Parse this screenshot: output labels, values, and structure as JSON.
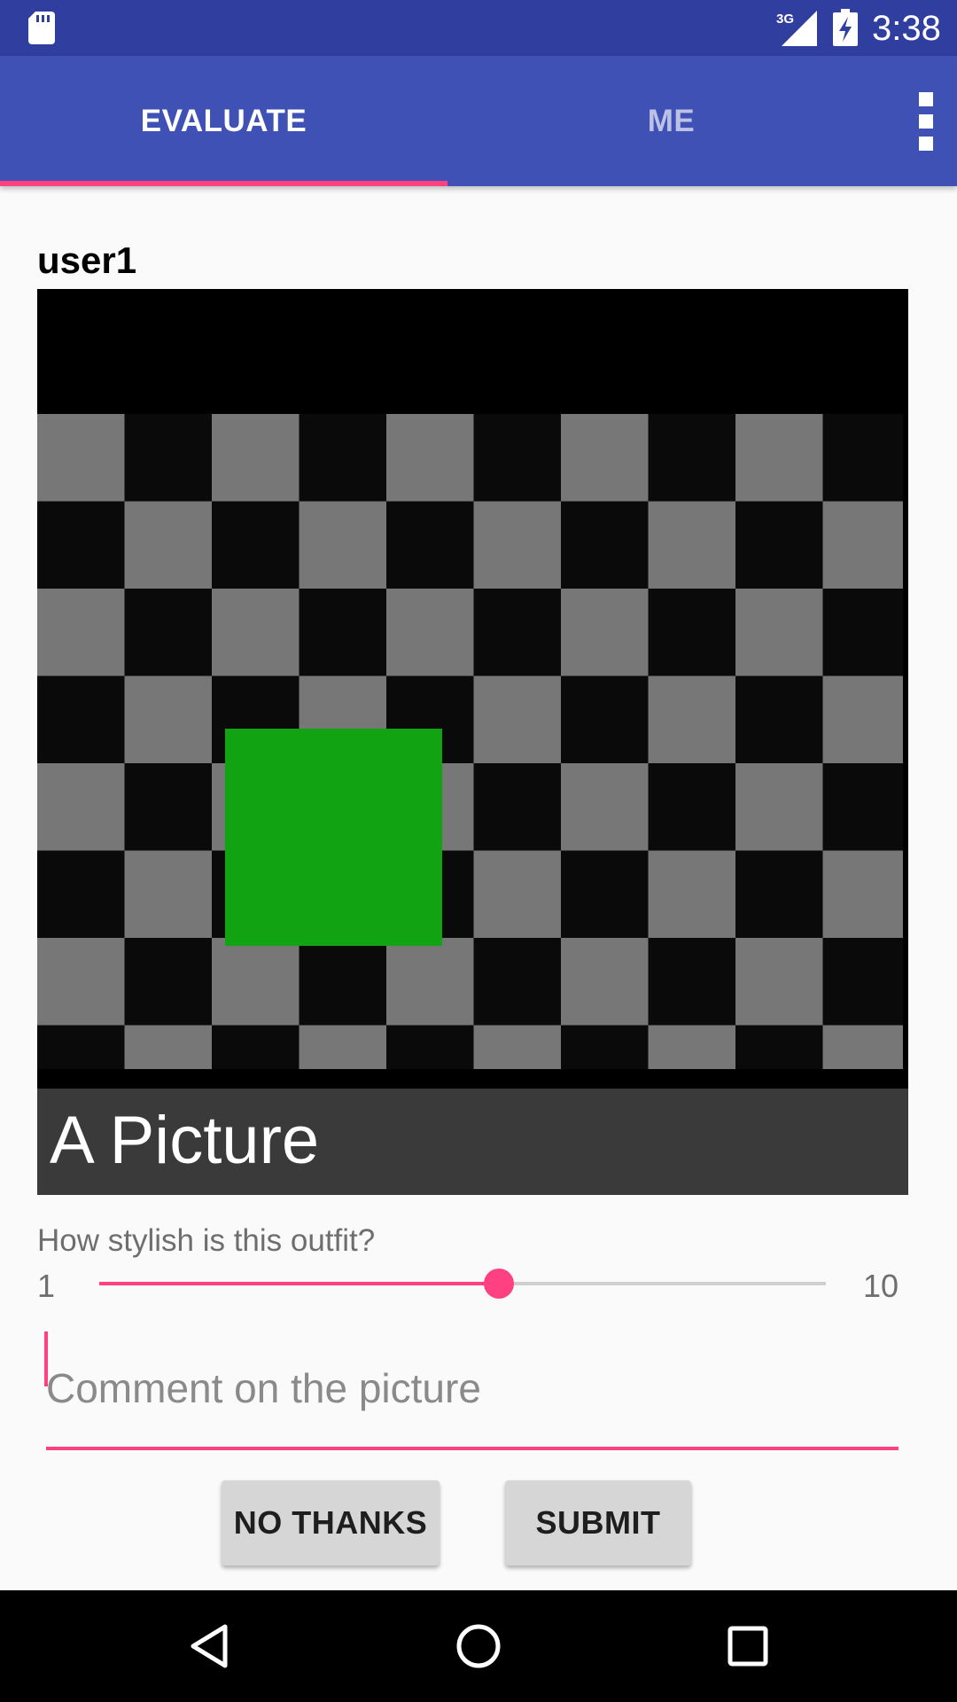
{
  "status_bar": {
    "time": "3:38",
    "network_label": "3G",
    "icons": [
      "sd-card-icon",
      "cell-signal-icon",
      "battery-charging-icon"
    ]
  },
  "tabs": [
    {
      "label": "EVALUATE",
      "selected": true
    },
    {
      "label": "ME",
      "selected": false
    }
  ],
  "app_bar": {
    "menu_icon": "more-vert-icon"
  },
  "post": {
    "username": "user1",
    "picture_caption": "A Picture"
  },
  "rating": {
    "question": "How stylish is this outfit?",
    "min_label": "1",
    "max_label": "10",
    "value_fraction": 0.55
  },
  "comment": {
    "placeholder": "Comment on the picture",
    "value": ""
  },
  "actions": {
    "no_thanks_label": "NO THANKS",
    "submit_label": "SUBMIT"
  },
  "nav_bar": {
    "icons": [
      "back-icon",
      "home-icon",
      "recents-icon"
    ]
  },
  "colors": {
    "primary": "#3f51b5",
    "primary_dark": "#303f9f",
    "accent": "#ff4081",
    "picture_square": "#12a312"
  }
}
